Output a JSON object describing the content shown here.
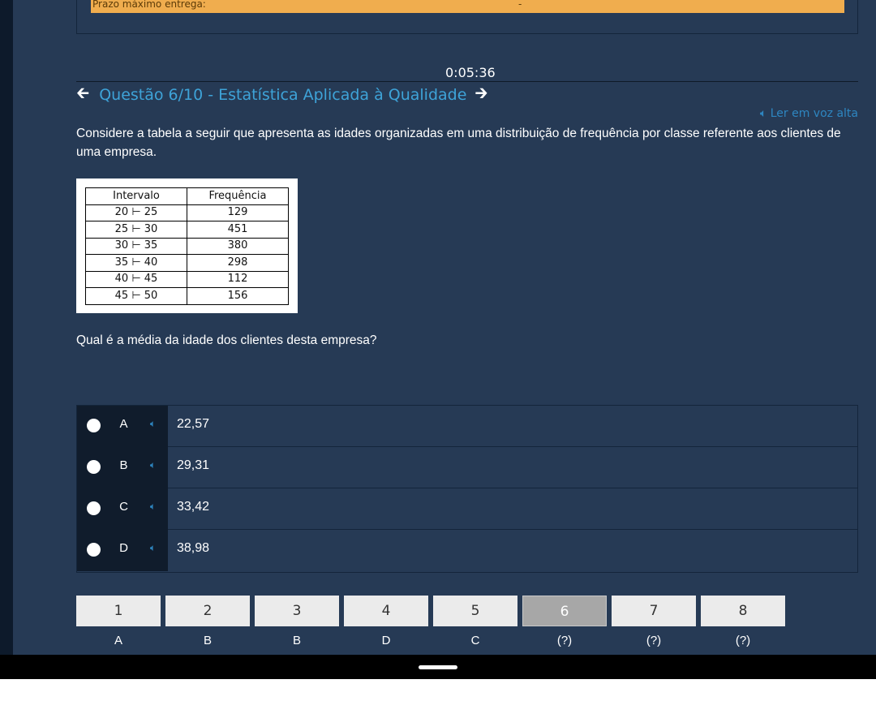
{
  "header": {
    "deadline_label": "Prazo máximo entrega:",
    "deadline_value": "-",
    "timer": "0:05:36"
  },
  "question_nav": {
    "prev_icon": "arrow-left-icon",
    "title": "Questão 6/10 - Estatística Aplicada à Qualidade",
    "next_icon": "arrow-right-icon"
  },
  "read_aloud": {
    "icon": "speaker-icon",
    "label": "Ler em voz alta"
  },
  "question": {
    "text": "Considere a tabela a seguir que apresenta as idades organizadas em uma distribuição de frequência por classe referente aos clientes de uma empresa.",
    "prompt": "Qual é a média da idade dos clientes desta empresa?"
  },
  "table": {
    "headers": [
      "Intervalo",
      "Frequência"
    ],
    "rows": [
      [
        "20 ⊢ 25",
        "129"
      ],
      [
        "25 ⊢ 30",
        "451"
      ],
      [
        "30 ⊢ 35",
        "380"
      ],
      [
        "35 ⊢ 40",
        "298"
      ],
      [
        "40 ⊢ 45",
        "112"
      ],
      [
        "45 ⊢ 50",
        "156"
      ]
    ]
  },
  "options": [
    {
      "letter": "A",
      "value": "22,57"
    },
    {
      "letter": "B",
      "value": "29,31"
    },
    {
      "letter": "C",
      "value": "33,42"
    },
    {
      "letter": "D",
      "value": "38,98"
    }
  ],
  "pager": [
    {
      "num": "1",
      "answer": "A"
    },
    {
      "num": "2",
      "answer": "B"
    },
    {
      "num": "3",
      "answer": "B"
    },
    {
      "num": "4",
      "answer": "D"
    },
    {
      "num": "5",
      "answer": "C"
    },
    {
      "num": "6",
      "answer": "(?)"
    },
    {
      "num": "7",
      "answer": "(?)"
    },
    {
      "num": "8",
      "answer": "(?)"
    }
  ],
  "pager_active": "6",
  "colors": {
    "background": "#263a55",
    "accent": "#3ea3d8",
    "deadline_bar": "#f0ad4e"
  }
}
